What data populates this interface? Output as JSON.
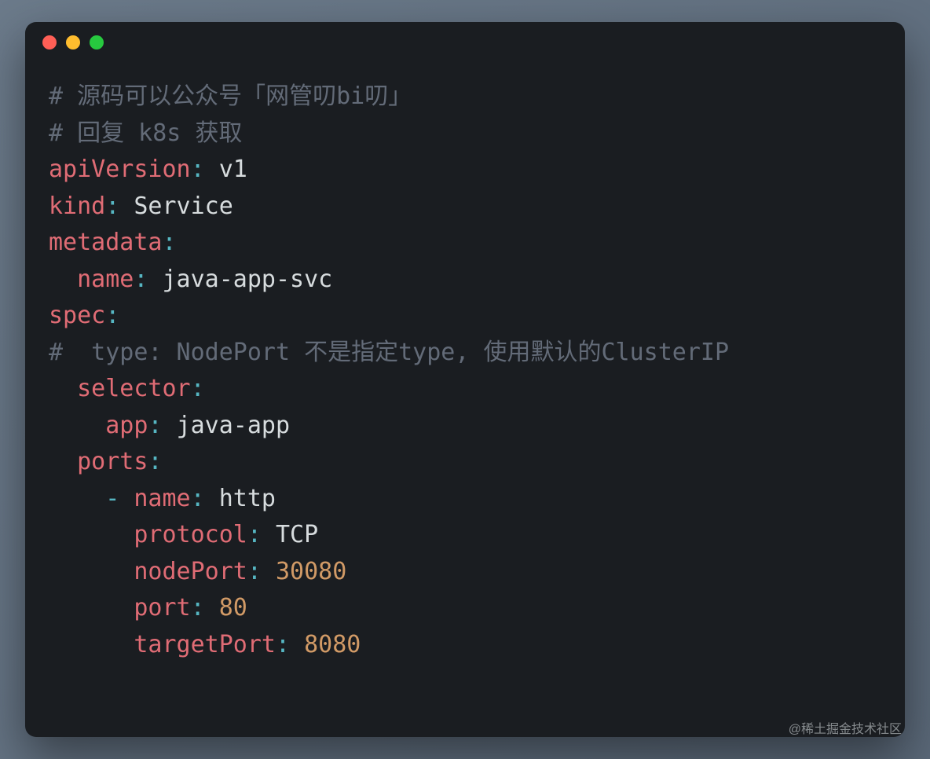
{
  "watermark": "@稀土掘金技术社区",
  "code": {
    "comment1": "# 源码可以公众号「网管叨bi叨」",
    "comment2": "# 回复 k8s 获取",
    "apiVersion_key": "apiVersion",
    "apiVersion_val": "v1",
    "kind_key": "kind",
    "kind_val": "Service",
    "metadata_key": "metadata",
    "metadata_name_key": "name",
    "metadata_name_val": "java-app-svc",
    "spec_key": "spec",
    "comment3": "#  type: NodePort 不是指定type, 使用默认的ClusterIP",
    "selector_key": "selector",
    "selector_app_key": "app",
    "selector_app_val": "java-app",
    "ports_key": "ports",
    "port_name_key": "name",
    "port_name_val": "http",
    "port_protocol_key": "protocol",
    "port_protocol_val": "TCP",
    "port_nodePort_key": "nodePort",
    "port_nodePort_val": "30080",
    "port_port_key": "port",
    "port_port_val": "80",
    "port_targetPort_key": "targetPort",
    "port_targetPort_val": "8080",
    "colon": ":",
    "dash": "-"
  }
}
